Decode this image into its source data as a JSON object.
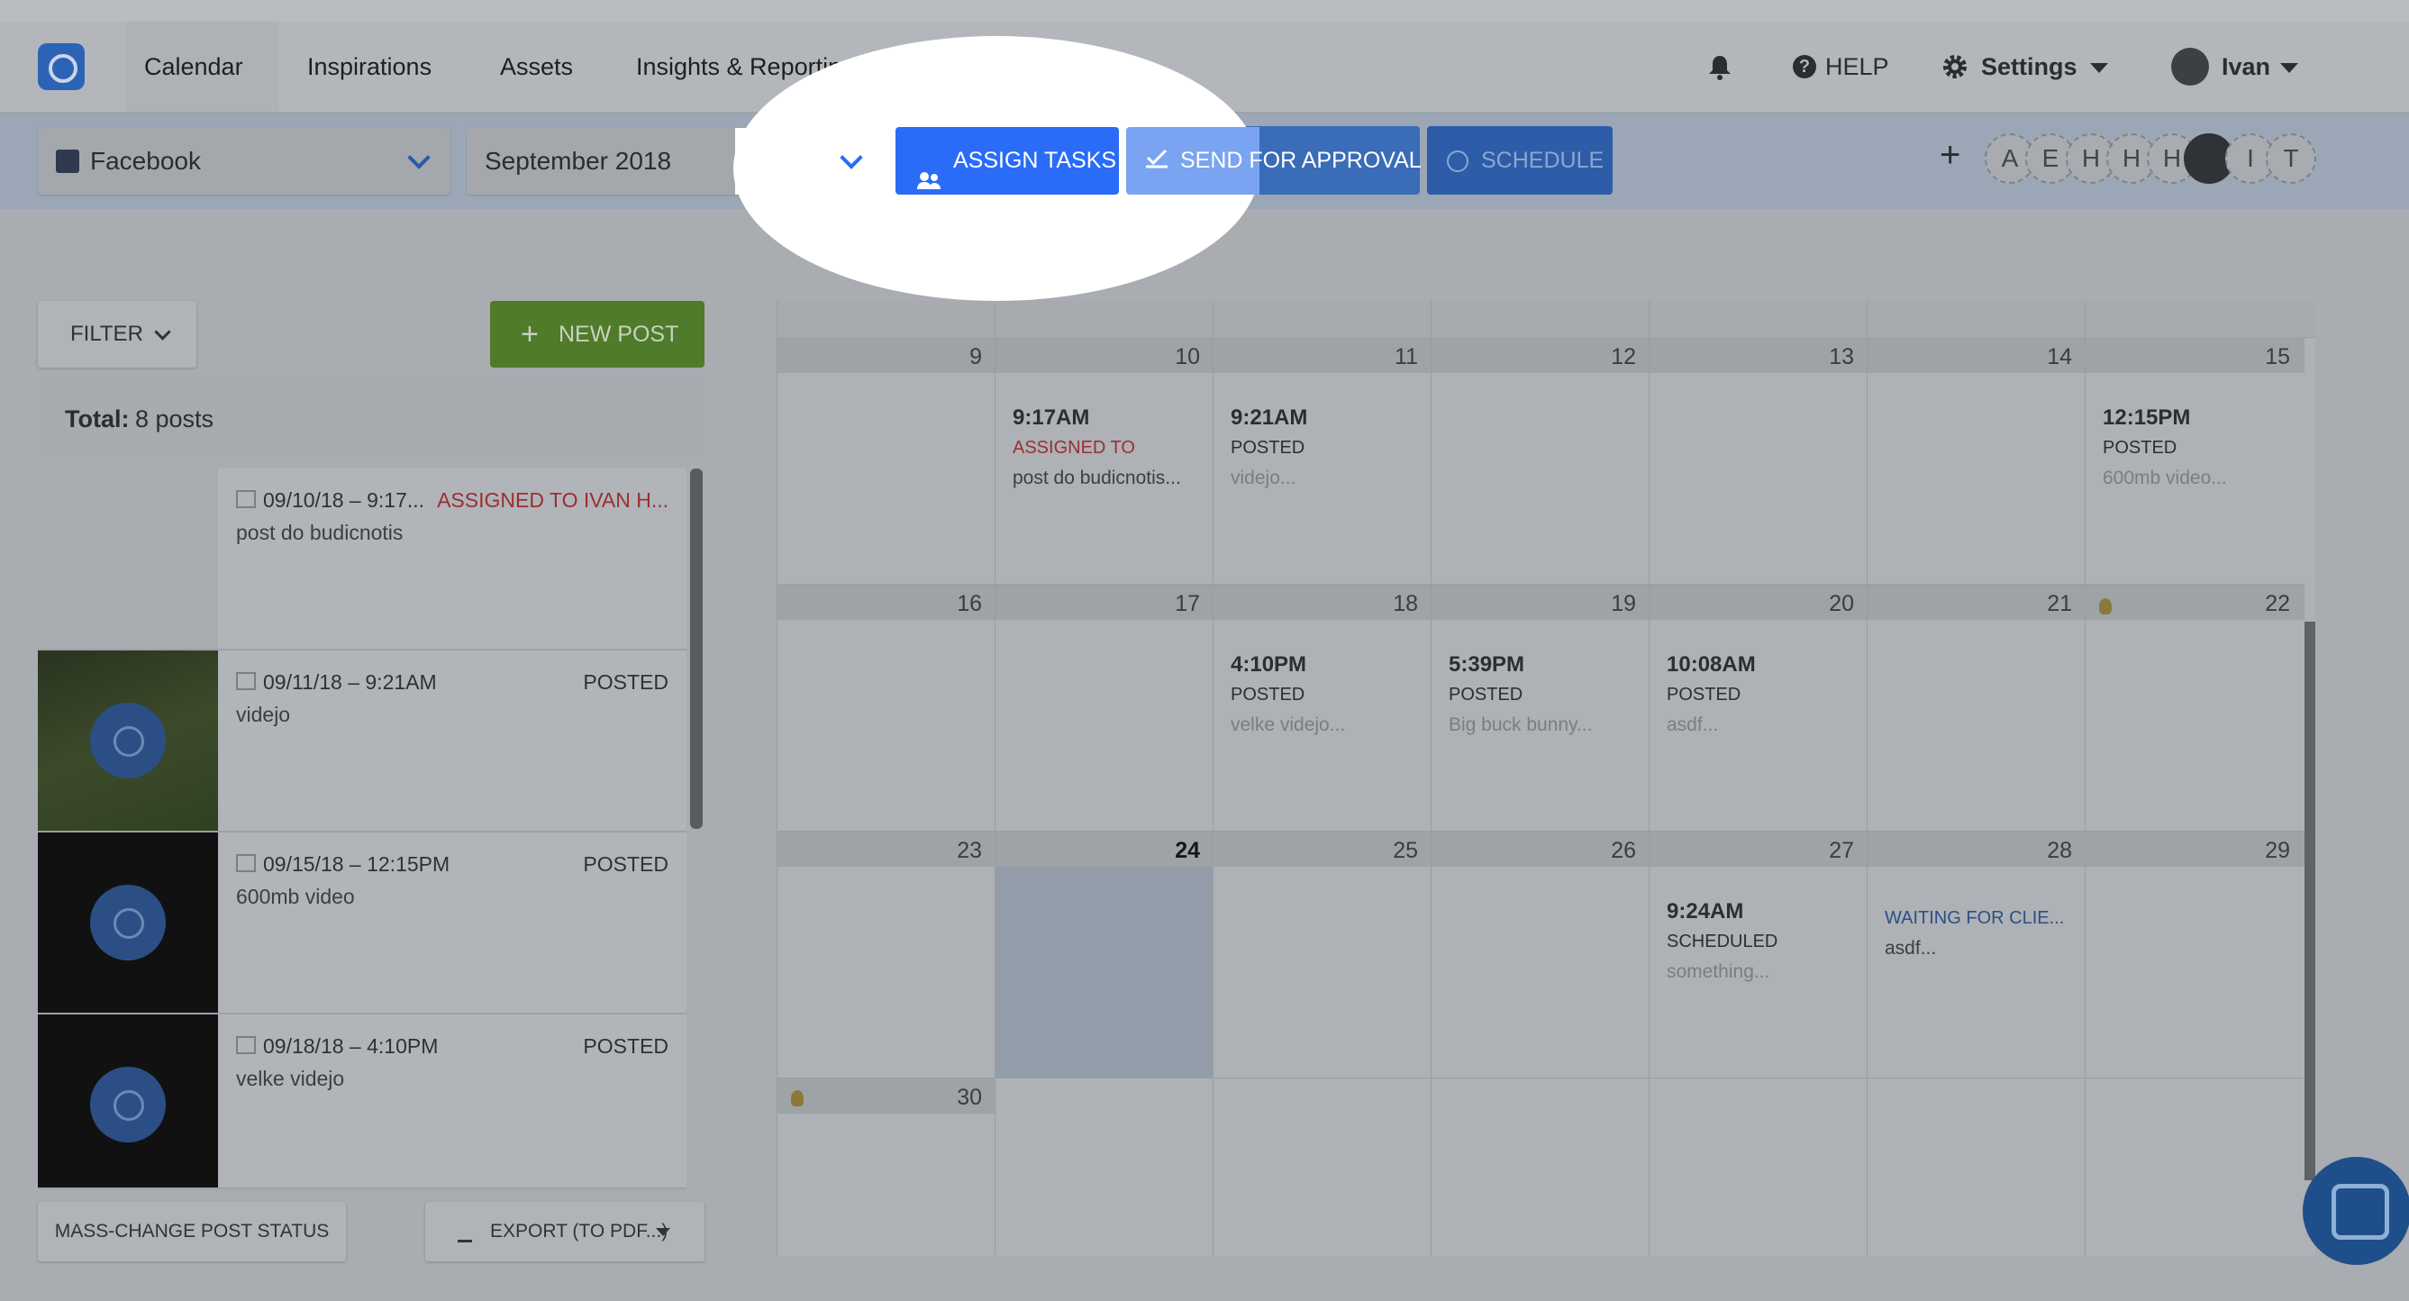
{
  "nav": {
    "items": [
      "Calendar",
      "Inspirations",
      "Assets",
      "Insights & Reporting"
    ],
    "help": "HELP",
    "settings": "Settings",
    "user": "Ivan"
  },
  "toolbar": {
    "network": "Facebook",
    "month": "September 2018",
    "assign": "ASSIGN TASKS",
    "approval": "SEND FOR APPROVAL",
    "schedule": "SCHEDULE",
    "plus": "+",
    "team": [
      "A",
      "E",
      "H",
      "H",
      "H",
      "",
      "I",
      "T"
    ]
  },
  "left": {
    "filter": "FILTER",
    "new_post": "NEW POST",
    "total_label": "Total:",
    "total_value": "8 posts",
    "posts": [
      {
        "date": "09/10/18 – 9:17...",
        "status": "ASSIGNED TO IVAN H...",
        "text": "post do budicnotis"
      },
      {
        "date": "09/11/18 – 9:21AM",
        "status": "POSTED",
        "text": "videjo"
      },
      {
        "date": "09/15/18 – 12:15PM",
        "status": "POSTED",
        "text": "600mb video"
      },
      {
        "date": "09/18/18 – 4:10PM",
        "status": "POSTED",
        "text": "velke videjo"
      }
    ],
    "mass_change": "MASS-CHANGE POST STATUS",
    "export": "EXPORT (TO PDF...)"
  },
  "calendar": {
    "weeks": [
      [
        "9",
        "10",
        "11",
        "12",
        "13",
        "14",
        "15"
      ],
      [
        "16",
        "17",
        "18",
        "19",
        "20",
        "21",
        "22"
      ],
      [
        "23",
        "24",
        "25",
        "26",
        "27",
        "28",
        "29"
      ],
      [
        "30",
        "",
        "",
        "",
        "",
        "",
        ""
      ]
    ],
    "events": {
      "e10": {
        "time": "9:17AM",
        "status": "ASSIGNED TO",
        "text": "post do budicnotis..."
      },
      "e11": {
        "time": "9:21AM",
        "status": "POSTED",
        "text": "videjo..."
      },
      "e15": {
        "time": "12:15PM",
        "status": "POSTED",
        "text": "600mb video..."
      },
      "e18": {
        "time": "4:10PM",
        "status": "POSTED",
        "text": "velke videjo..."
      },
      "e19": {
        "time": "5:39PM",
        "status": "POSTED",
        "text": "Big buck bunny..."
      },
      "e20": {
        "time": "10:08AM",
        "status": "POSTED",
        "text": "asdf..."
      },
      "e27": {
        "time": "9:24AM",
        "status": "SCHEDULED",
        "text": "something..."
      },
      "e28": {
        "status": "WAITING FOR CLIE...",
        "text": "asdf..."
      }
    }
  },
  "colors": {
    "accent": "#2a6cf7",
    "assigned": "#c33a3a",
    "new_post": "#4f7b2a"
  }
}
